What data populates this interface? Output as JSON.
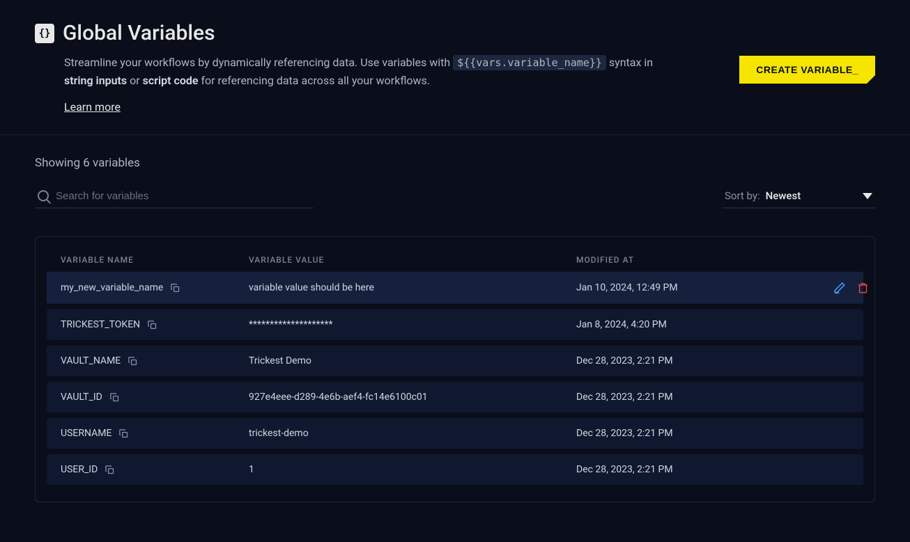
{
  "header": {
    "title": "Global Variables",
    "description_part1": "Streamline your workflows by dynamically referencing data. Use variables with ",
    "description_code": "${{vars.variable_name}}",
    "description_part2": " syntax in ",
    "description_bold1": "string inputs",
    "description_part3": " or ",
    "description_bold2": "script code",
    "description_part4": " for referencing data across all your workflows.",
    "learn_more": "Learn more",
    "create_button": "CREATE VARIABLE_"
  },
  "showing": "Showing 6 variables",
  "search": {
    "placeholder": "Search for variables"
  },
  "sort": {
    "label": "Sort by:",
    "value": "Newest"
  },
  "table": {
    "columns": {
      "name": "VARIABLE NAME",
      "value": "VARIABLE VALUE",
      "modified": "MODIFIED AT"
    },
    "rows": [
      {
        "name": "my_new_variable_name",
        "value": "variable value should be here",
        "modified": "Jan 10, 2024, 12:49 PM",
        "active": true
      },
      {
        "name": "TRICKEST_TOKEN",
        "value": "********************",
        "modified": "Jan 8, 2024, 4:20 PM",
        "active": false
      },
      {
        "name": "VAULT_NAME",
        "value": "Trickest Demo",
        "modified": "Dec 28, 2023, 2:21 PM",
        "active": false
      },
      {
        "name": "VAULT_ID",
        "value": "927e4eee-d289-4e6b-aef4-fc14e6100c01",
        "modified": "Dec 28, 2023, 2:21 PM",
        "active": false
      },
      {
        "name": "USERNAME",
        "value": "trickest-demo",
        "modified": "Dec 28, 2023, 2:21 PM",
        "active": false
      },
      {
        "name": "USER_ID",
        "value": "1",
        "modified": "Dec 28, 2023, 2:21 PM",
        "active": false
      }
    ]
  }
}
